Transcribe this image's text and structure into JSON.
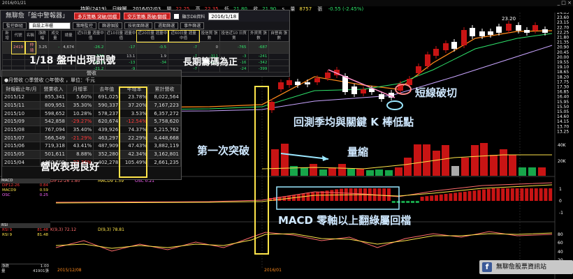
{
  "window": {
    "date": "2016/01/21",
    "controls": "_ □ ×"
  },
  "quote": {
    "label_code": "持股(2419)",
    "label_kind": "日線圖",
    "date": "2016/02/03",
    "open_label": "開",
    "open": "22.25",
    "high_label": "高",
    "high": "22.35",
    "low_label": "低",
    "low": "21.80",
    "close_label": "收",
    "close": "21.90",
    "unit": "s",
    "volume_label": "量",
    "volume": "8757",
    "unit2": "張",
    "change": "-0.55 (-2.45%)"
  },
  "panel": {
    "brand": "無聊詹「盤中警報器」",
    "buttons": [
      "多方策略 突破/回檔",
      "空方策略 跌破/翻檔"
    ],
    "checkbox_label": "顯示DB資料",
    "date_value": "2016/1/18",
    "tool_buttons": [
      "監控群組",
      "自設上市櫃",
      "策略監控",
      "篩選個股",
      "技術面篩選",
      "週期篩選",
      "事件篩選",
      "外掛報表",
      "交易明細",
      "盤後提示"
    ],
    "table_headers": [
      "新增",
      "代號",
      "名稱",
      "漲跌幅",
      "成交量",
      "總量",
      "近5日量 週量中值",
      "近10日量 週量中值",
      "近20日量 週量中值",
      "近60日量 週量中值",
      "投信買 張數",
      "投信近10 日買賣",
      "外資買 張數",
      "自營商 張數"
    ],
    "rows": [
      [
        "",
        "2419",
        "仲琦",
        "3.25",
        "-",
        "4,674",
        "-26.2",
        "-17",
        "-0.5",
        "-7",
        "0",
        "-765",
        "-687",
        ""
      ],
      [
        "",
        "",
        "",
        "",
        "",
        "",
        "-174",
        "13.1",
        "1.9",
        "-7",
        "-311",
        "-3",
        "-241",
        ""
      ],
      [
        "",
        "",
        "",
        "",
        "",
        "",
        "-12.6",
        "-13",
        "-34",
        "0",
        "-101",
        "-16",
        "-342",
        ""
      ],
      [
        "",
        "",
        "",
        "",
        "",
        "",
        "-21.2",
        "-9",
        "",
        "-7",
        "",
        "-24",
        "-399",
        ""
      ]
    ]
  },
  "callouts": {
    "signal": "1/18 盤中出現訊號",
    "chips": "長期籌碼為正",
    "revenue_good": "營收表現良好"
  },
  "revenue": {
    "title": "營收",
    "options": "●月營收 ○季營收 ○年營收 ，單位：千元",
    "headers": [
      "財報截止年/月",
      "營業收入",
      "月增率",
      "去年值",
      "年增率",
      "累計營收"
    ],
    "rows": [
      [
        "2015/12",
        "855,341",
        "5.60%",
        "691,025",
        "23.78%",
        "8,022,564"
      ],
      [
        "2015/11",
        "809,951",
        "35.30%",
        "590,337",
        "37.20%",
        "7,167,223"
      ],
      [
        "2015/10",
        "598,652",
        "10.28%",
        "578,237",
        "3.53%",
        "6,357,272"
      ],
      [
        "2015/09",
        "542,858",
        "-29.27%",
        "620,674",
        "-12.54%",
        "5,758,620"
      ],
      [
        "2015/08",
        "767,094",
        "35.40%",
        "439,926",
        "74.37%",
        "5,215,762"
      ],
      [
        "2015/07",
        "566,549",
        "-21.29%",
        "463,297",
        "22.29%",
        "4,448,668"
      ],
      [
        "2015/06",
        "719,318",
        "43.41%",
        "487,909",
        "47.43%",
        "3,882,119"
      ],
      [
        "2015/05",
        "501,611",
        "8.88%",
        "352,280",
        "42.34%",
        "3,162,801"
      ],
      [
        "2015/04",
        "460,705",
        "-22.36%",
        "402,278",
        "105.49%",
        "2,661,235"
      ]
    ]
  },
  "annotations": {
    "breakout": "第一次突破",
    "shrink": "量縮",
    "macd": "MACD 零軸以上翻綠屬回檔",
    "short_break": "短線破切",
    "retest": "回測季均與關鍵 K 棒低點"
  },
  "price_axis": [
    "24.05",
    "23.60",
    "23.15",
    "22.70",
    "22.25",
    "21.80",
    "21.35",
    "20.90",
    "20.45",
    "20.00",
    "19.55",
    "19.10",
    "18.65",
    "18.20",
    "17.75",
    "17.30",
    "16.85",
    "16.40",
    "15.95",
    "15.50",
    "15.05",
    "14.60",
    "14.15",
    "13.70",
    "13.25"
  ],
  "price_high_label": "23.20",
  "volume_axis": [
    "40K",
    "20K"
  ],
  "macd": {
    "label": "MACD",
    "dif": "DIF12-26 1.80",
    "macd9": "MACD9 1.59",
    "osc": "OSC 0.21",
    "axis": [
      "1",
      "0",
      "-1"
    ],
    "left": [
      "DIF12-26",
      "MACD9",
      "OSC"
    ],
    "left_vals": [
      "0.84",
      "0.59",
      "0.25"
    ]
  },
  "rsi": {
    "label": "RSI",
    "k": "K(9,3) 72.12",
    "d": "D(9,3) 78.81",
    "axis": [
      "80",
      "60",
      "40",
      "20"
    ],
    "left": [
      "RSI 9",
      "RSI 9"
    ],
    "left_vals": [
      "81.48",
      "81.48"
    ]
  },
  "xaxis": {
    "left_date": "2015/12/08",
    "mid_date": "2016/01"
  },
  "bottom_left": {
    "label1": "漲跌",
    "label2": "量",
    "val1": "1.00",
    "val2": "41901張"
  },
  "footer": {
    "page_name": "無聊詹股票資訊站",
    "icon": "f"
  },
  "colors": {
    "up": "#c81414",
    "down": "#17a64a",
    "ma_orange": "#ff8a1c",
    "ma_green": "#2fe36b",
    "highlight": "#ffe54a",
    "cyan_box": "#9be7ff"
  }
}
